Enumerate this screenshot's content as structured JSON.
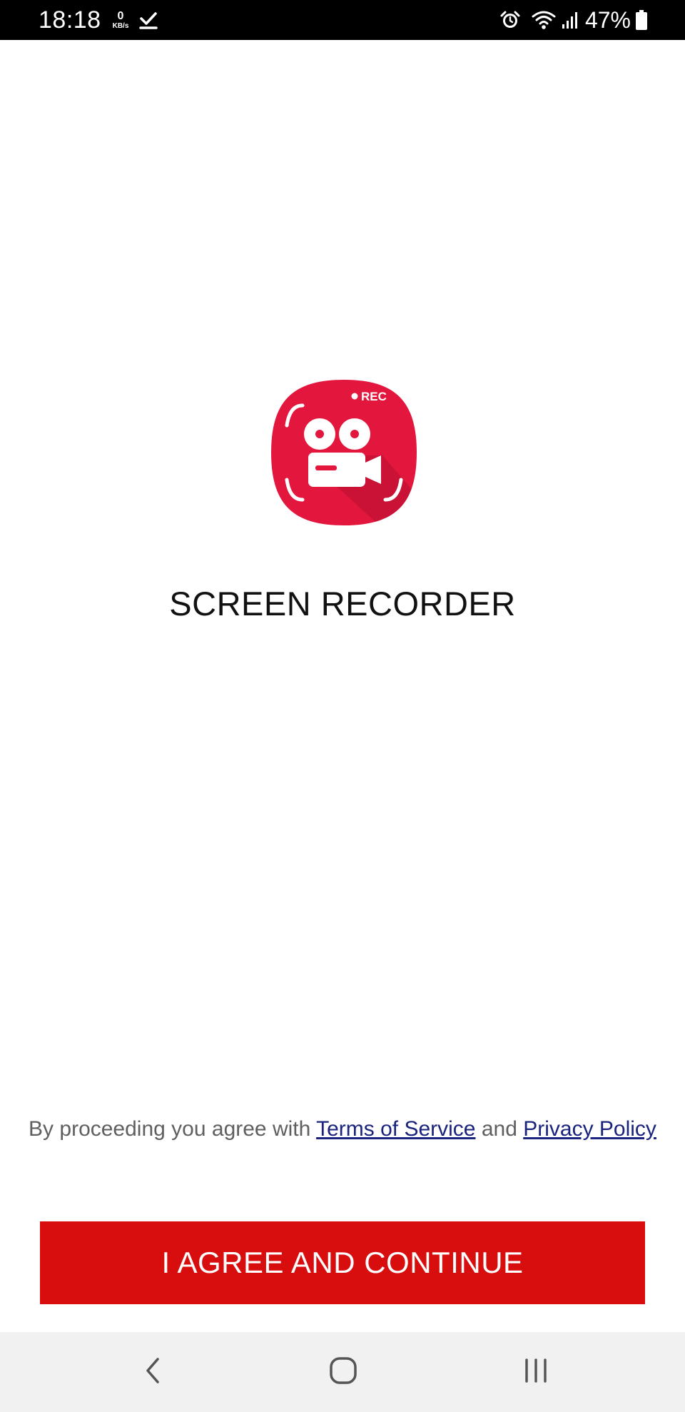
{
  "status_bar": {
    "time": "18:18",
    "net_speed_value": "0",
    "net_speed_unit": "KB/s",
    "battery_percent": "47%",
    "icons": [
      "download-done-icon",
      "alarm-icon",
      "wifi-icon",
      "signal-icon",
      "battery-icon"
    ]
  },
  "app": {
    "icon_badge": "REC",
    "title": "SCREEN RECORDER",
    "brand_color": "#e3173e"
  },
  "consent": {
    "prefix": "By proceeding you agree with ",
    "terms_link": "Terms of Service",
    "conjunction": " and ",
    "privacy_link": "Privacy Policy",
    "link_color": "#1a237e"
  },
  "agree_button": {
    "label": "I AGREE AND CONTINUE",
    "color": "#d80e0e"
  },
  "nav_bar": {
    "buttons": [
      "back-icon",
      "home-icon",
      "recents-icon"
    ]
  }
}
